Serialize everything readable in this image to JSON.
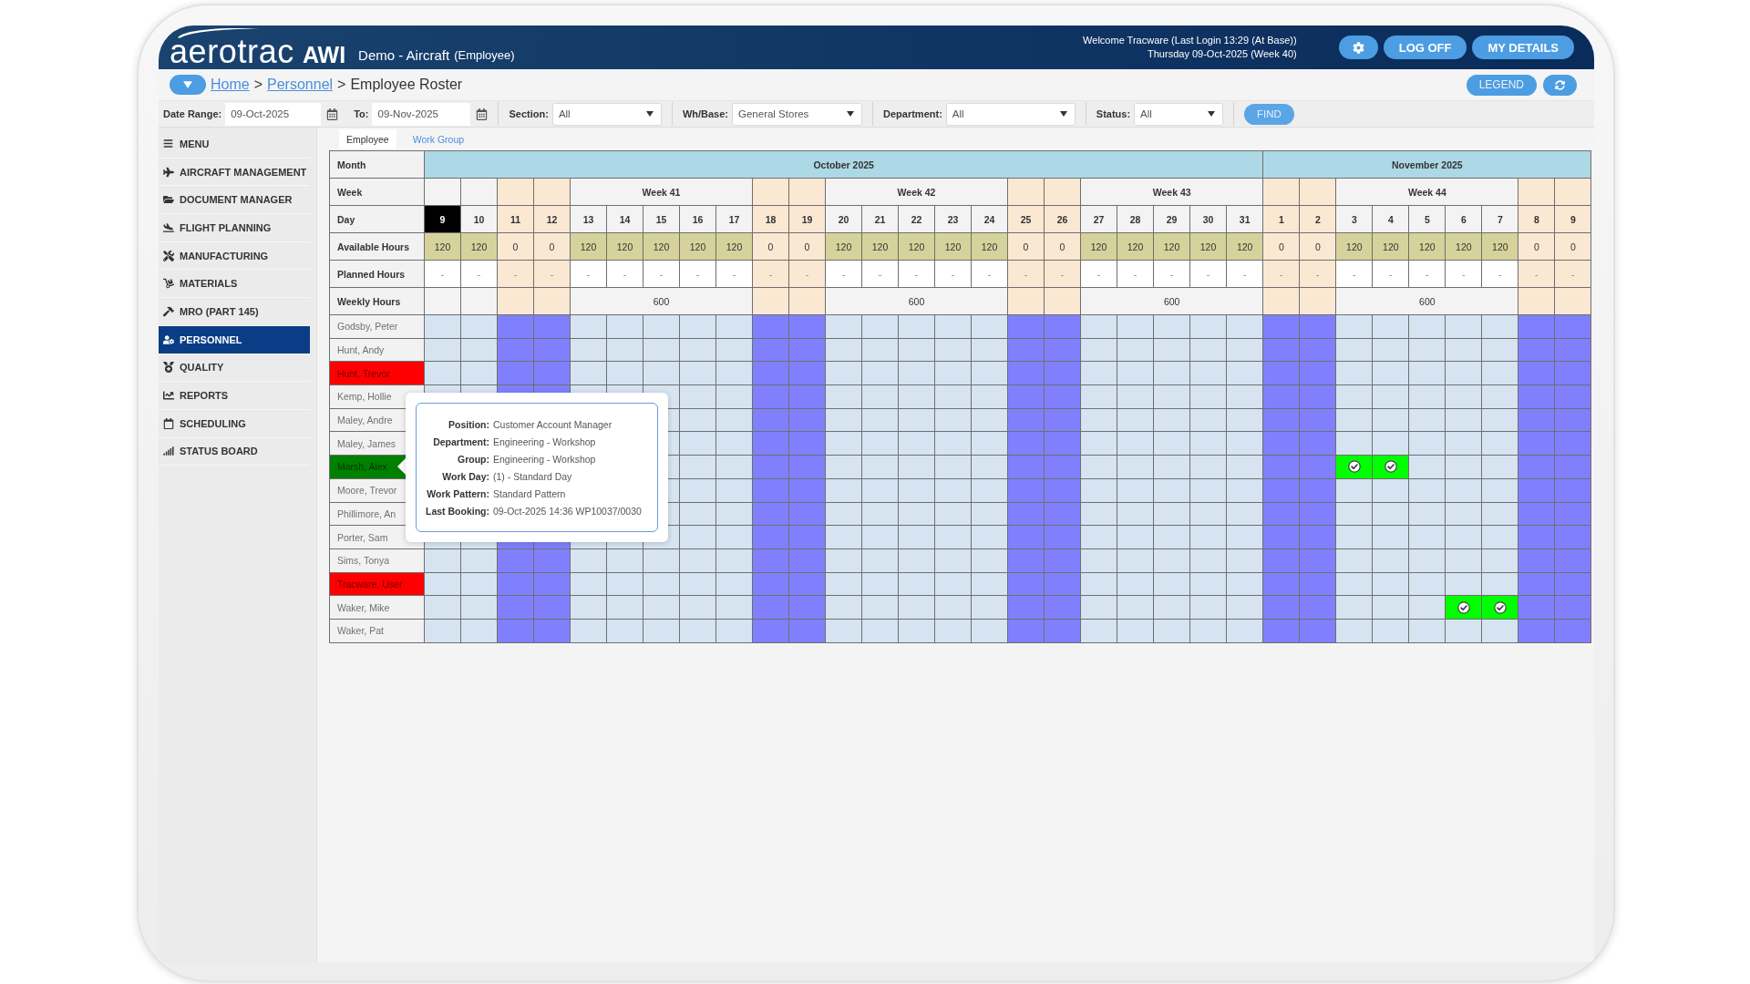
{
  "header": {
    "wordmark": "aerotrac",
    "wordmark_suffix": "AWI",
    "title": "Demo - Aircraft",
    "subtitle": "(Employee)",
    "welcome": "Welcome Tracware (Last Login 13:29 (At Base))",
    "date_line": "Thursday 09-Oct-2025 (Week 40)",
    "buttons": [
      {
        "kind": "icon"
      },
      {
        "kind": "text",
        "label": "LOG OFF"
      },
      {
        "kind": "text",
        "label": "MY DETAILS"
      }
    ]
  },
  "breadcrumb": [
    {
      "kind": "link",
      "label": "Home"
    },
    {
      "kind": "separator",
      "label": ">"
    },
    {
      "kind": "link",
      "label": "Personnel"
    },
    {
      "kind": "separator",
      "label": ">"
    },
    {
      "kind": "current",
      "label": "Employee Roster"
    }
  ],
  "toolbar_buttons": [
    {
      "kind": "text",
      "label": "LEGEND"
    },
    {
      "kind": "icon"
    }
  ],
  "filters": [
    {
      "kind": "date",
      "label": "Date Range:",
      "value": "09-Oct-2025"
    },
    {
      "kind": "date",
      "label": "To:",
      "value": "09-Nov-2025"
    },
    {
      "kind": "select",
      "label": "Section:",
      "value": "All"
    },
    {
      "kind": "select",
      "label": "Wh/Base:",
      "value": "General Stores"
    },
    {
      "kind": "select",
      "label": "Department:",
      "value": "All"
    },
    {
      "kind": "select",
      "label": "Status:",
      "value": "All"
    }
  ],
  "find_button": "FIND",
  "sidebar": {
    "menu": "MENU",
    "items": [
      {
        "label": "AIRCRAFT MANAGEMENT",
        "selected": false
      },
      {
        "label": "DOCUMENT MANAGER",
        "selected": false
      },
      {
        "label": "FLIGHT PLANNING",
        "selected": false
      },
      {
        "label": "MANUFACTURING",
        "selected": false
      },
      {
        "label": "MATERIALS",
        "selected": false
      },
      {
        "label": "MRO (PART 145)",
        "selected": false
      },
      {
        "label": "PERSONNEL",
        "selected": true
      },
      {
        "label": "QUALITY",
        "selected": false
      },
      {
        "label": "REPORTS",
        "selected": false
      },
      {
        "label": "SCHEDULING",
        "selected": false
      },
      {
        "label": "STATUS BOARD",
        "selected": false
      }
    ]
  },
  "tabs": [
    {
      "label": "Employee",
      "selected": true
    },
    {
      "label": "Work Group",
      "selected": false
    }
  ],
  "roster": {
    "row_labels": {
      "month": "Month",
      "week": "Week",
      "day": "Day",
      "available": "Available Hours",
      "planned": "Planned Hours",
      "weekly": "Weekly Hours"
    },
    "months": [
      {
        "label": "October 2025",
        "segments": [
          {
            "kind": "partial",
            "days": [
              {
                "day": "9",
                "selected": true,
                "available": "120",
                "planned": "-"
              },
              {
                "day": "10",
                "selected": false,
                "available": "120",
                "planned": "-"
              }
            ]
          },
          {
            "kind": "weekend",
            "days": [
              {
                "day": "11",
                "selected": false,
                "available": "0",
                "planned": "-"
              },
              {
                "day": "12",
                "selected": false,
                "available": "0",
                "planned": "-"
              }
            ]
          },
          {
            "kind": "week",
            "label": "Week 41",
            "weekly_hours": "600",
            "days": [
              {
                "day": "13",
                "selected": false,
                "available": "120",
                "planned": "-"
              },
              {
                "day": "14",
                "selected": false,
                "available": "120",
                "planned": "-"
              },
              {
                "day": "15",
                "selected": false,
                "available": "120",
                "planned": "-"
              },
              {
                "day": "16",
                "selected": false,
                "available": "120",
                "planned": "-"
              },
              {
                "day": "17",
                "selected": false,
                "available": "120",
                "planned": "-"
              }
            ]
          },
          {
            "kind": "weekend",
            "days": [
              {
                "day": "18",
                "selected": false,
                "available": "0",
                "planned": "-"
              },
              {
                "day": "19",
                "selected": false,
                "available": "0",
                "planned": "-"
              }
            ]
          },
          {
            "kind": "week",
            "label": "Week 42",
            "weekly_hours": "600",
            "days": [
              {
                "day": "20",
                "selected": false,
                "available": "120",
                "planned": "-"
              },
              {
                "day": "21",
                "selected": false,
                "available": "120",
                "planned": "-"
              },
              {
                "day": "22",
                "selected": false,
                "available": "120",
                "planned": "-"
              },
              {
                "day": "23",
                "selected": false,
                "available": "120",
                "planned": "-"
              },
              {
                "day": "24",
                "selected": false,
                "available": "120",
                "planned": "-"
              }
            ]
          },
          {
            "kind": "weekend",
            "days": [
              {
                "day": "25",
                "selected": false,
                "available": "0",
                "planned": "-"
              },
              {
                "day": "26",
                "selected": false,
                "available": "0",
                "planned": "-"
              }
            ]
          },
          {
            "kind": "week",
            "label": "Week 43",
            "weekly_hours": "600",
            "days": [
              {
                "day": "27",
                "selected": false,
                "available": "120",
                "planned": "-"
              },
              {
                "day": "28",
                "selected": false,
                "available": "120",
                "planned": "-"
              },
              {
                "day": "29",
                "selected": false,
                "available": "120",
                "planned": "-"
              },
              {
                "day": "30",
                "selected": false,
                "available": "120",
                "planned": "-"
              },
              {
                "day": "31",
                "selected": false,
                "available": "120",
                "planned": "-"
              }
            ]
          }
        ]
      },
      {
        "label": "November 2025",
        "segments": [
          {
            "kind": "weekend",
            "days": [
              {
                "day": "1",
                "selected": false,
                "available": "0",
                "planned": "-"
              },
              {
                "day": "2",
                "selected": false,
                "available": "0",
                "planned": "-"
              }
            ]
          },
          {
            "kind": "week",
            "label": "Week 44",
            "weekly_hours": "600",
            "days": [
              {
                "day": "3",
                "selected": false,
                "available": "120",
                "planned": "-"
              },
              {
                "day": "4",
                "selected": false,
                "available": "120",
                "planned": "-"
              },
              {
                "day": "5",
                "selected": false,
                "available": "120",
                "planned": "-"
              },
              {
                "day": "6",
                "selected": false,
                "available": "120",
                "planned": "-"
              },
              {
                "day": "7",
                "selected": false,
                "available": "120",
                "planned": "-"
              }
            ]
          },
          {
            "kind": "weekend",
            "days": [
              {
                "day": "8",
                "selected": false,
                "available": "0",
                "planned": "-"
              },
              {
                "day": "9",
                "selected": false,
                "available": "0",
                "planned": "-"
              }
            ]
          }
        ]
      }
    ],
    "employees": [
      {
        "name": "Godsby, Peter",
        "shifts": [
          {
            "booked": false
          },
          {
            "booked": false
          },
          {
            "booked": false
          },
          {
            "booked": false
          },
          {
            "booked": false
          },
          {
            "booked": false
          },
          {
            "booked": false
          },
          {
            "booked": false
          },
          {
            "booked": false
          },
          {
            "booked": false
          },
          {
            "booked": false
          },
          {
            "booked": false
          },
          {
            "booked": false
          },
          {
            "booked": false
          },
          {
            "booked": false
          },
          {
            "booked": false
          },
          {
            "booked": false
          },
          {
            "booked": false
          },
          {
            "booked": false
          },
          {
            "booked": false
          },
          {
            "booked": false
          },
          {
            "booked": false
          },
          {
            "booked": false
          },
          {
            "booked": false
          },
          {
            "booked": false
          },
          {
            "booked": false
          },
          {
            "booked": false
          },
          {
            "booked": false
          },
          {
            "booked": false
          },
          {
            "booked": false
          },
          {
            "booked": false
          },
          {
            "booked": false
          }
        ]
      },
      {
        "name": "Hunt, Andy",
        "shifts": [
          {
            "booked": false
          },
          {
            "booked": false
          },
          {
            "booked": false
          },
          {
            "booked": false
          },
          {
            "booked": false
          },
          {
            "booked": false
          },
          {
            "booked": false
          },
          {
            "booked": false
          },
          {
            "booked": false
          },
          {
            "booked": false
          },
          {
            "booked": false
          },
          {
            "booked": false
          },
          {
            "booked": false
          },
          {
            "booked": false
          },
          {
            "booked": false
          },
          {
            "booked": false
          },
          {
            "booked": false
          },
          {
            "booked": false
          },
          {
            "booked": false
          },
          {
            "booked": false
          },
          {
            "booked": false
          },
          {
            "booked": false
          },
          {
            "booked": false
          },
          {
            "booked": false
          },
          {
            "booked": false
          },
          {
            "booked": false
          },
          {
            "booked": false
          },
          {
            "booked": false
          },
          {
            "booked": false
          },
          {
            "booked": false
          },
          {
            "booked": false
          },
          {
            "booked": false
          }
        ]
      },
      {
        "name": "Hunt, Trevor",
        "color": "#ff0000",
        "shifts": [
          {
            "booked": false
          },
          {
            "booked": false
          },
          {
            "booked": false
          },
          {
            "booked": false
          },
          {
            "booked": false
          },
          {
            "booked": false
          },
          {
            "booked": false
          },
          {
            "booked": false
          },
          {
            "booked": false
          },
          {
            "booked": false
          },
          {
            "booked": false
          },
          {
            "booked": false
          },
          {
            "booked": false
          },
          {
            "booked": false
          },
          {
            "booked": false
          },
          {
            "booked": false
          },
          {
            "booked": false
          },
          {
            "booked": false
          },
          {
            "booked": false
          },
          {
            "booked": false
          },
          {
            "booked": false
          },
          {
            "booked": false
          },
          {
            "booked": false
          },
          {
            "booked": false
          },
          {
            "booked": false
          },
          {
            "booked": false
          },
          {
            "booked": false
          },
          {
            "booked": false
          },
          {
            "booked": false
          },
          {
            "booked": false
          },
          {
            "booked": false
          },
          {
            "booked": false
          }
        ]
      },
      {
        "name": "Kemp, Hollie",
        "shifts": [
          {
            "booked": false
          },
          {
            "booked": false
          },
          {
            "booked": false
          },
          {
            "booked": false
          },
          {
            "booked": false
          },
          {
            "booked": false
          },
          {
            "booked": false
          },
          {
            "booked": false
          },
          {
            "booked": false
          },
          {
            "booked": false
          },
          {
            "booked": false
          },
          {
            "booked": false
          },
          {
            "booked": false
          },
          {
            "booked": false
          },
          {
            "booked": false
          },
          {
            "booked": false
          },
          {
            "booked": false
          },
          {
            "booked": false
          },
          {
            "booked": false
          },
          {
            "booked": false
          },
          {
            "booked": false
          },
          {
            "booked": false
          },
          {
            "booked": false
          },
          {
            "booked": false
          },
          {
            "booked": false
          },
          {
            "booked": false
          },
          {
            "booked": false
          },
          {
            "booked": false
          },
          {
            "booked": false
          },
          {
            "booked": false
          },
          {
            "booked": false
          },
          {
            "booked": false
          }
        ]
      },
      {
        "name": "Maley, Andre",
        "shifts": [
          {
            "booked": false
          },
          {
            "booked": false
          },
          {
            "booked": false
          },
          {
            "booked": false
          },
          {
            "booked": false
          },
          {
            "booked": false
          },
          {
            "booked": false
          },
          {
            "booked": false
          },
          {
            "booked": false
          },
          {
            "booked": false
          },
          {
            "booked": false
          },
          {
            "booked": false
          },
          {
            "booked": false
          },
          {
            "booked": false
          },
          {
            "booked": false
          },
          {
            "booked": false
          },
          {
            "booked": false
          },
          {
            "booked": false
          },
          {
            "booked": false
          },
          {
            "booked": false
          },
          {
            "booked": false
          },
          {
            "booked": false
          },
          {
            "booked": false
          },
          {
            "booked": false
          },
          {
            "booked": false
          },
          {
            "booked": false
          }
        ]
      },
      {
        "name": "Maley, James",
        "shifts": [
          {
            "booked": false
          },
          {
            "booked": false
          },
          {
            "booked": false
          },
          {
            "booked": false
          },
          {
            "booked": false
          },
          {
            "booked": false
          },
          {
            "booked": false
          },
          {
            "booked": false
          },
          {
            "booked": false
          },
          {
            "booked": false
          },
          {
            "booked": false
          },
          {
            "booked": false
          },
          {
            "booked": false
          },
          {
            "booked": false
          },
          {
            "booked": false
          },
          {
            "booked": false
          },
          {
            "booked": false
          },
          {
            "booked": false
          },
          {
            "booked": false
          },
          {
            "booked": false
          },
          {
            "booked": false
          },
          {
            "booked": false
          },
          {
            "booked": false
          },
          {
            "booked": false
          },
          {
            "booked": false
          },
          {
            "booked": false
          }
        ]
      },
      {
        "name": "Marsh, Alex",
        "color": "#008000",
        "shifts": [
          {
            "booked": false
          },
          {
            "booked": false
          },
          {
            "booked": false
          },
          {
            "booked": false
          },
          {
            "booked": false
          },
          {
            "booked": false
          },
          {
            "booked": false
          },
          {
            "booked": false
          },
          {
            "booked": false
          },
          {
            "booked": false
          },
          {
            "booked": false
          },
          {
            "booked": false
          },
          {
            "booked": false
          },
          {
            "booked": false
          },
          {
            "booked": false
          },
          {
            "booked": false
          },
          {
            "booked": false
          },
          {
            "booked": false
          },
          {
            "booked": false
          },
          {
            "booked": true
          },
          {
            "booked": true
          },
          {
            "booked": false
          },
          {
            "booked": false
          },
          {
            "booked": false
          },
          {
            "booked": false
          },
          {
            "booked": false
          }
        ]
      },
      {
        "name": "Moore, Trevor",
        "shifts": [
          {
            "booked": false
          },
          {
            "booked": false
          },
          {
            "booked": false
          },
          {
            "booked": false
          },
          {
            "booked": false
          },
          {
            "booked": false
          },
          {
            "booked": false
          },
          {
            "booked": false
          },
          {
            "booked": false
          },
          {
            "booked": false
          },
          {
            "booked": false
          },
          {
            "booked": false
          },
          {
            "booked": false
          },
          {
            "booked": false
          },
          {
            "booked": false
          },
          {
            "booked": false
          },
          {
            "booked": false
          },
          {
            "booked": false
          },
          {
            "booked": false
          },
          {
            "booked": false
          },
          {
            "booked": false
          },
          {
            "booked": false
          },
          {
            "booked": false
          },
          {
            "booked": false
          },
          {
            "booked": false
          },
          {
            "booked": false
          }
        ]
      },
      {
        "name": "Phillimore, An",
        "shifts": [
          {
            "booked": false
          },
          {
            "booked": false
          },
          {
            "booked": false
          },
          {
            "booked": false
          },
          {
            "booked": false
          },
          {
            "booked": false
          },
          {
            "booked": false
          },
          {
            "booked": false
          },
          {
            "booked": false
          },
          {
            "booked": false
          },
          {
            "booked": false
          },
          {
            "booked": false
          },
          {
            "booked": false
          },
          {
            "booked": false
          },
          {
            "booked": false
          },
          {
            "booked": false
          },
          {
            "booked": false
          },
          {
            "booked": false
          },
          {
            "booked": false
          },
          {
            "booked": false
          },
          {
            "booked": false
          },
          {
            "booked": false
          },
          {
            "booked": false
          },
          {
            "booked": false
          },
          {
            "booked": false
          },
          {
            "booked": false
          }
        ]
      },
      {
        "name": "Porter, Sam",
        "shifts": [
          {
            "booked": false
          },
          {
            "booked": false
          },
          {
            "booked": false
          },
          {
            "booked": false
          },
          {
            "booked": false
          },
          {
            "booked": false
          },
          {
            "booked": false
          },
          {
            "booked": false
          },
          {
            "booked": false
          },
          {
            "booked": false
          },
          {
            "booked": false
          },
          {
            "booked": false
          },
          {
            "booked": false
          },
          {
            "booked": false
          },
          {
            "booked": false
          },
          {
            "booked": false
          },
          {
            "booked": false
          },
          {
            "booked": false
          },
          {
            "booked": false
          },
          {
            "booked": false
          },
          {
            "booked": false
          },
          {
            "booked": false
          },
          {
            "booked": false
          },
          {
            "booked": false
          },
          {
            "booked": false
          },
          {
            "booked": false
          },
          {
            "booked": false
          },
          {
            "booked": false
          },
          {
            "booked": false
          },
          {
            "booked": false
          },
          {
            "booked": false
          },
          {
            "booked": false
          }
        ]
      },
      {
        "name": "Sims, Tonya",
        "shifts": [
          {
            "booked": false
          },
          {
            "booked": false
          },
          {
            "booked": false
          },
          {
            "booked": false
          },
          {
            "booked": false
          },
          {
            "booked": false
          },
          {
            "booked": false
          },
          {
            "booked": false
          },
          {
            "booked": false
          },
          {
            "booked": false
          },
          {
            "booked": false
          },
          {
            "booked": false
          },
          {
            "booked": false
          },
          {
            "booked": false
          },
          {
            "booked": false
          },
          {
            "booked": false
          },
          {
            "booked": false
          },
          {
            "booked": false
          },
          {
            "booked": false
          },
          {
            "booked": false
          },
          {
            "booked": false
          },
          {
            "booked": false
          },
          {
            "booked": false
          },
          {
            "booked": false
          },
          {
            "booked": false
          },
          {
            "booked": false
          },
          {
            "booked": false
          },
          {
            "booked": false
          },
          {
            "booked": false
          },
          {
            "booked": false
          },
          {
            "booked": false
          },
          {
            "booked": false
          }
        ]
      },
      {
        "name": "Tracware, User",
        "color": "#ff0000",
        "shifts": [
          {
            "booked": false
          },
          {
            "booked": false
          },
          {
            "booked": false
          },
          {
            "booked": false
          },
          {
            "booked": false
          },
          {
            "booked": false
          },
          {
            "booked": false
          },
          {
            "booked": false
          },
          {
            "booked": false
          },
          {
            "booked": false
          },
          {
            "booked": false
          },
          {
            "booked": false
          },
          {
            "booked": false
          },
          {
            "booked": false
          },
          {
            "booked": false
          },
          {
            "booked": false
          },
          {
            "booked": false
          },
          {
            "booked": false
          },
          {
            "booked": false
          },
          {
            "booked": false
          },
          {
            "booked": false
          },
          {
            "booked": false
          },
          {
            "booked": false
          },
          {
            "booked": false
          },
          {
            "booked": false
          },
          {
            "booked": false
          },
          {
            "booked": false
          },
          {
            "booked": false
          },
          {
            "booked": false
          },
          {
            "booked": false
          },
          {
            "booked": false
          },
          {
            "booked": false
          }
        ]
      },
      {
        "name": "Waker, Mike",
        "shifts": [
          {
            "booked": false
          },
          {
            "booked": false
          },
          {
            "booked": false
          },
          {
            "booked": false
          },
          {
            "booked": false
          },
          {
            "booked": false
          },
          {
            "booked": false
          },
          {
            "booked": false
          },
          {
            "booked": false
          },
          {
            "booked": false
          },
          {
            "booked": false
          },
          {
            "booked": false
          },
          {
            "booked": false
          },
          {
            "booked": false
          },
          {
            "booked": false
          },
          {
            "booked": false
          },
          {
            "booked": false
          },
          {
            "booked": false
          },
          {
            "booked": false
          },
          {
            "booked": false
          },
          {
            "booked": false
          },
          {
            "booked": false
          },
          {
            "booked": false
          },
          {
            "booked": false
          },
          {
            "booked": false
          },
          {
            "booked": false
          },
          {
            "booked": false
          },
          {
            "booked": false
          },
          {
            "booked": true
          },
          {
            "booked": true
          },
          {
            "booked": false
          },
          {
            "booked": false
          }
        ]
      },
      {
        "name": "Waker, Pat",
        "shifts": [
          {
            "booked": false
          },
          {
            "booked": false
          },
          {
            "booked": false
          },
          {
            "booked": false
          },
          {
            "booked": false
          },
          {
            "booked": false
          },
          {
            "booked": false
          },
          {
            "booked": false
          },
          {
            "booked": false
          },
          {
            "booked": false
          },
          {
            "booked": false
          },
          {
            "booked": false
          },
          {
            "booked": false
          },
          {
            "booked": false
          },
          {
            "booked": false
          },
          {
            "booked": false
          },
          {
            "booked": false
          },
          {
            "booked": false
          },
          {
            "booked": false
          },
          {
            "booked": false
          },
          {
            "booked": false
          },
          {
            "booked": false
          },
          {
            "booked": false
          },
          {
            "booked": false
          },
          {
            "booked": false
          },
          {
            "booked": false
          },
          {
            "booked": false
          },
          {
            "booked": false
          },
          {
            "booked": false
          },
          {
            "booked": false
          },
          {
            "booked": false
          },
          {
            "booked": false
          }
        ]
      }
    ]
  },
  "tooltip": {
    "rows": [
      {
        "label": "Position:",
        "value": "Customer Account Manager"
      },
      {
        "label": "Department:",
        "value": "Engineering - Workshop"
      },
      {
        "label": "Group:",
        "value": "Engineering - Workshop"
      },
      {
        "label": "Work Day:",
        "value": "(1) - Standard Day"
      },
      {
        "label": "Work Pattern:",
        "value": "Standard Pattern"
      },
      {
        "label": "Last Booking:",
        "value": "09-Oct-2025 14:36 WP10037/0030"
      }
    ]
  }
}
